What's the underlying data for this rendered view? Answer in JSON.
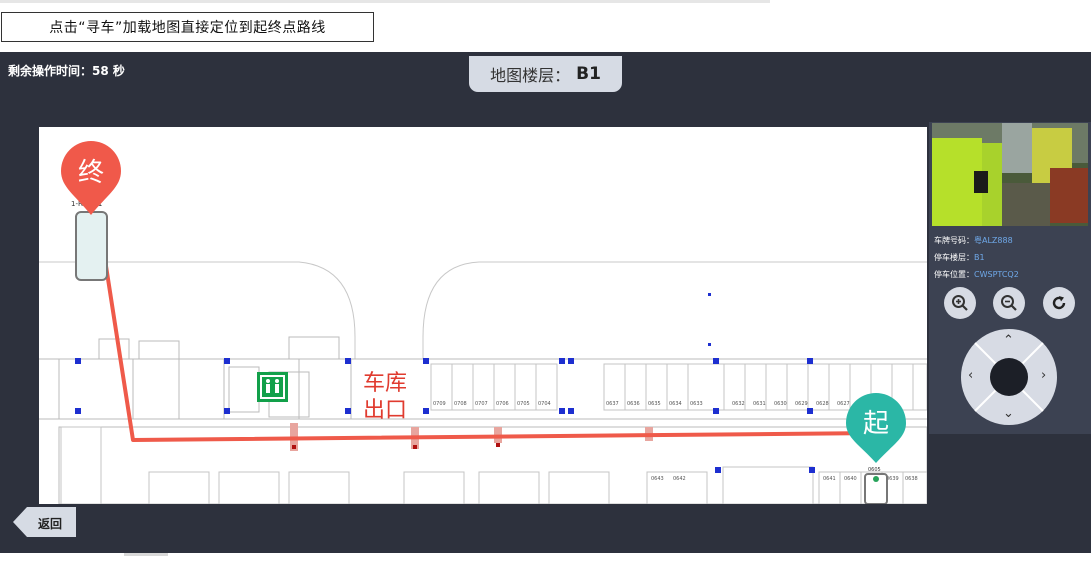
{
  "caption": "点击“寻车”加载地图直接定位到起终点路线",
  "timer": {
    "label": "剩余操作时间：",
    "value": "58 秒"
  },
  "floor": {
    "label": "地图楼层：",
    "value": "B1"
  },
  "map": {
    "end_marker": "终",
    "start_marker": "起",
    "end_spot_label": "1-R1-W.1",
    "start_spot_label": "0605",
    "exit_label_line1": "车库",
    "exit_label_line2": "出口",
    "spot_numbers_upper": [
      "0709",
      "0708",
      "0707",
      "0706",
      "0705",
      "0704",
      "0637",
      "0636",
      "0635",
      "0634",
      "0633",
      "0632",
      "0631",
      "0630",
      "0629",
      "0628",
      "0627",
      "0626"
    ],
    "spot_numbers_lower": [
      "0643",
      "0642",
      "0641",
      "0640",
      "0639",
      "0638"
    ],
    "route_color": "#ef5a4a",
    "end_marker_color": "#f0594a",
    "start_marker_color": "#2bb7a6"
  },
  "vehicle": {
    "plate_label": "车牌号码：",
    "plate": "粤ALZ888",
    "floor_label": "停车楼层：",
    "floor": "B1",
    "spot_label": "停车位置：",
    "spot": "CWSPTCQ2"
  },
  "controls": {
    "zoom_in_icon": "zoom-in-icon",
    "zoom_out_icon": "zoom-out-icon",
    "reset_icon": "rotate-icon"
  },
  "back": {
    "label": "返回"
  }
}
